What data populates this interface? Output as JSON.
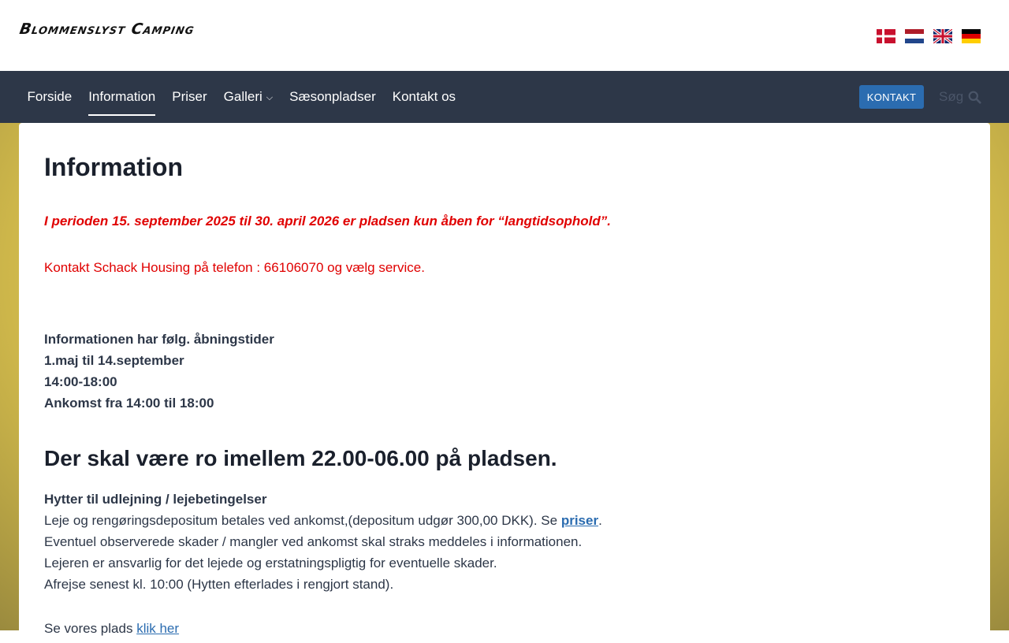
{
  "site": {
    "logo": "Blommenslyst Camping"
  },
  "languages": [
    {
      "code": "da",
      "name": "Dansk"
    },
    {
      "code": "nl",
      "name": "Nederlands"
    },
    {
      "code": "en",
      "name": "English"
    },
    {
      "code": "de",
      "name": "Deutsch"
    }
  ],
  "nav": {
    "items": [
      {
        "label": "Forside"
      },
      {
        "label": "Information",
        "active": true
      },
      {
        "label": "Priser"
      },
      {
        "label": "Galleri",
        "dropdown": true
      },
      {
        "label": "Sæsonpladser"
      },
      {
        "label": "Kontakt os"
      }
    ],
    "cta": "KONTAKT",
    "search_label": "Søg"
  },
  "page": {
    "title": "Information",
    "notice": "I perioden 15. september 2025 til 30. april 2026 er pladsen kun åben for “langtidsophold”.",
    "contact": "Kontakt Schack Housing på telefon : 66106070 og vælg service.",
    "hours": [
      "Informationen har følg. åbningstider",
      "1.maj til 14.september",
      "14:00-18:00",
      "Ankomst fra 14:00 til 18:00"
    ],
    "quiet_heading": "Der skal være ro imellem 22.00-06.00 på pladsen.",
    "cabins": {
      "heading": "Hytter til udlejning / lejebetingelser",
      "line1_prefix": "Leje og rengøringsdepositum betales ved ankomst,(depositum udgør 300,00 DKK). Se ",
      "line1_link": "priser",
      "line1_suffix": ".",
      "line2": "Eventuel observerede skader / mangler ved ankomst skal straks meddeles i informationen.",
      "line3": "Lejeren er ansvarlig for det lejede og erstatningspligtig for eventuelle skader.",
      "line4": "Afrejse senest kl. 10:00 (Hytten efterlades i rengjort stand)."
    },
    "more_prefix": "Se vores plads ",
    "more_link": "klik her"
  },
  "colors": {
    "nav_bg": "#2d3748",
    "accent": "#2b6cb0",
    "notice_red": "#e00000"
  }
}
